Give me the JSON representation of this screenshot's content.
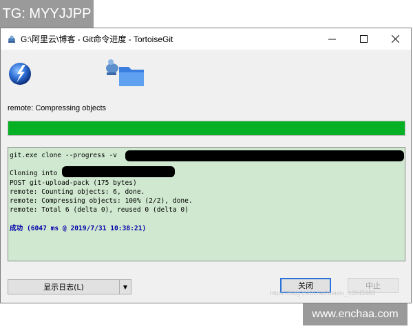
{
  "watermark_top": "TG: MYYJJPP",
  "watermark_bottom": "www.enchaa.com",
  "watermark_faint": "https://blog.csdn.net/weixin_43945983",
  "window": {
    "title": "G:\\阿里云\\博客 - Git命令进度 - TortoiseGit",
    "controls": [
      "minimize-icon",
      "maximize-icon",
      "close-icon"
    ]
  },
  "status": "remote: Compressing objects",
  "progress": {
    "percent": 100,
    "color": "#06b025"
  },
  "log": {
    "background": "#cfe8cf",
    "lines": [
      "git.exe clone --progress -v",
      "",
      "Cloning into",
      "POST git-upload-pack (175 bytes)",
      "remote: Counting objects: 6, done.",
      "remote: Compressing objects: 100% (2/2), done.",
      "remote: Total 6 (delta 0), reused 0 (delta 0)",
      "",
      "成功 (6047 ms @ 2019/7/31 10:38:21)"
    ]
  },
  "buttons": {
    "show_log": "显示日志(L)",
    "close": "关闭",
    "abort": "中止"
  }
}
